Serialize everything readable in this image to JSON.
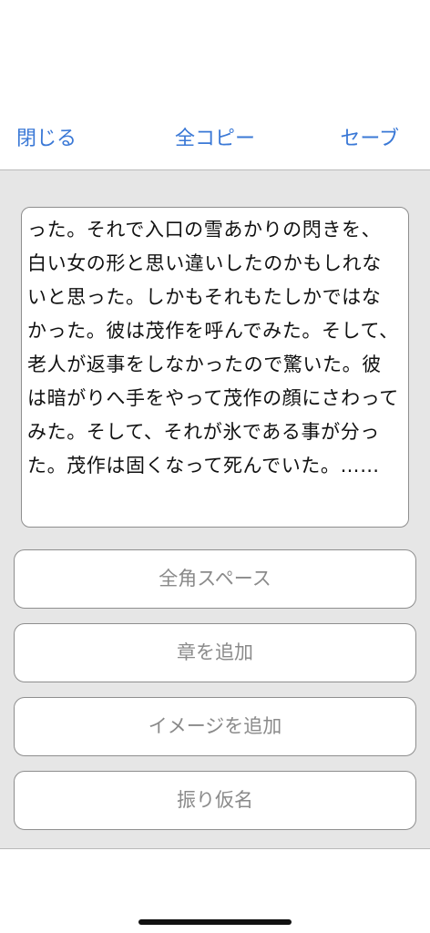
{
  "navbar": {
    "close_label": "閉じる",
    "copy_all_label": "全コピー",
    "save_label": "セーブ"
  },
  "editor": {
    "text": "った。それで入口の雪あかりの閃きを、白い女の形と思い違いしたのかもしれないと思った。しかもそれもたしかではなかった。彼は茂作を呼んでみた。そして、老人が返事をしなかったので驚いた。彼は暗がりへ手をやって茂作の顔にさわってみた。そして、それが氷である事が分った。茂作は固くなって死んでいた。……"
  },
  "actions": [
    {
      "label": "全角スペース"
    },
    {
      "label": "章を追加"
    },
    {
      "label": "イメージを追加"
    },
    {
      "label": "振り仮名"
    }
  ]
}
